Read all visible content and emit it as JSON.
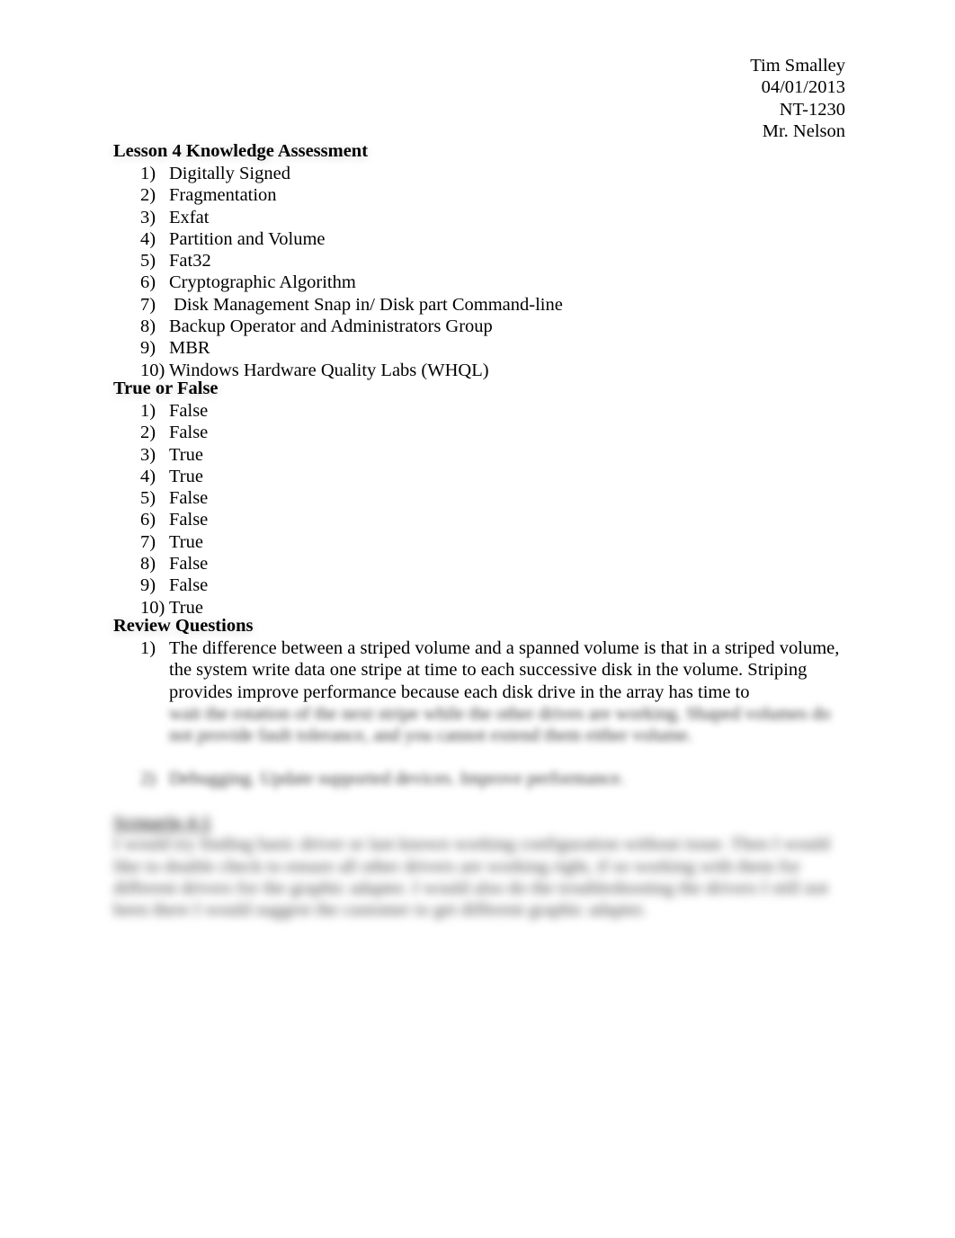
{
  "header": {
    "name": "Tim Smalley",
    "date": "04/01/2013",
    "course": "NT-1230",
    "instructor": "Mr. Nelson"
  },
  "knowledge": {
    "title": "Lesson 4 Knowledge Assessment",
    "items": [
      {
        "num": "1)",
        "text": "Digitally Signed"
      },
      {
        "num": "2)",
        "text": "Fragmentation"
      },
      {
        "num": "3)",
        "text": "Exfat"
      },
      {
        "num": "4)",
        "text": "Partition and Volume"
      },
      {
        "num": "5)",
        "text": "Fat32"
      },
      {
        "num": "6)",
        "text": "Cryptographic Algorithm"
      },
      {
        "num": "7)",
        "text": " Disk Management Snap in/ Disk part Command-line"
      },
      {
        "num": "8)",
        "text": "Backup Operator and Administrators Group"
      },
      {
        "num": "9)",
        "text": "MBR"
      },
      {
        "num": "10)",
        "text": "Windows Hardware Quality Labs (WHQL)"
      }
    ]
  },
  "truefalse": {
    "title": "True or False",
    "items": [
      {
        "num": "1)",
        "text": "False"
      },
      {
        "num": "2)",
        "text": "False"
      },
      {
        "num": "3)",
        "text": "True"
      },
      {
        "num": "4)",
        "text": "True"
      },
      {
        "num": "5)",
        "text": "False"
      },
      {
        "num": "6)",
        "text": "False"
      },
      {
        "num": "7)",
        "text": "True"
      },
      {
        "num": "8)",
        "text": "False"
      },
      {
        "num": "9)",
        "text": "False"
      },
      {
        "num": "10)",
        "text": "True"
      }
    ]
  },
  "review": {
    "title": "Review Questions",
    "items": [
      {
        "num": "1)",
        "text": "The difference between a striped volume and a spanned volume is that in a striped volume, the system write data one stripe at time to each successive disk in the volume. Striping provides improve performance because each disk drive in the array has time to",
        "blurred_text": "wait the rotation of the next stripe while the other drives are working. Shaped volumes do not provide fault tolerance, and you cannot extend them either volume."
      },
      {
        "num": "2)",
        "blurred_text": "Debugging. Update supported devices. Improve performance."
      }
    ]
  },
  "scenario": {
    "blurred_title": "Scenario 4-1",
    "blurred_text": "I would try finding basic driver or last known working configuration without issue. Then I would like to double check to ensure all other drivers are working right, if so working with them for different drivers for the graphic adapter. I would also do the troubleshooting the drivers I still not been there I would suggest the customer to get different graphic adapter."
  }
}
